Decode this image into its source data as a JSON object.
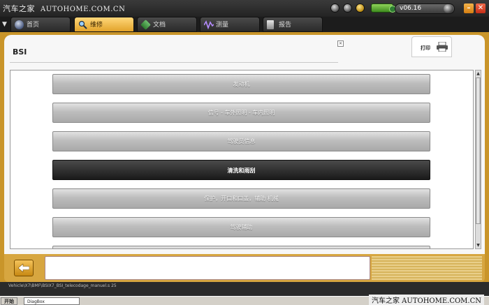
{
  "watermark": {
    "brand": "汽车之家",
    "url": "AUTOHOME.COM.CN"
  },
  "watermark_bottom": "汽车之家  AUTOHOME.COM.CN",
  "app": {
    "version": "v06.16"
  },
  "tabs": [
    {
      "label": "首页",
      "icon": "home-icon",
      "active": false
    },
    {
      "label": "维修",
      "icon": "search-icon",
      "active": true
    },
    {
      "label": "文档",
      "icon": "document-icon",
      "active": false
    },
    {
      "label": "测量",
      "icon": "waveform-icon",
      "active": false
    },
    {
      "label": "报告",
      "icon": "report-icon",
      "active": false
    }
  ],
  "panel": {
    "title": "BSI",
    "print_label": "打印"
  },
  "menu": [
    {
      "label": "发动机",
      "selected": false
    },
    {
      "label": "信号 - 车外照明 - 车内照明",
      "selected": false
    },
    {
      "label": "驾驶员信息",
      "selected": false
    },
    {
      "label": "清洗和雨刮",
      "selected": true
    },
    {
      "label": "保护，开口和口盖，辅助 机械",
      "selected": false
    },
    {
      "label": "驾驶辅助",
      "selected": false
    },
    {
      "label": "",
      "selected": false
    }
  ],
  "status_path": "Vehicle\\X7\\BMF\\BSIX7_BSI_telecodage_manuel.s  25",
  "taskbar": {
    "start_label": "开始",
    "task_label": "DiagBox"
  },
  "colors": {
    "accent": "#c9952a",
    "active_tab": "#e2a32a",
    "selected_row": "#1a1a1a"
  }
}
